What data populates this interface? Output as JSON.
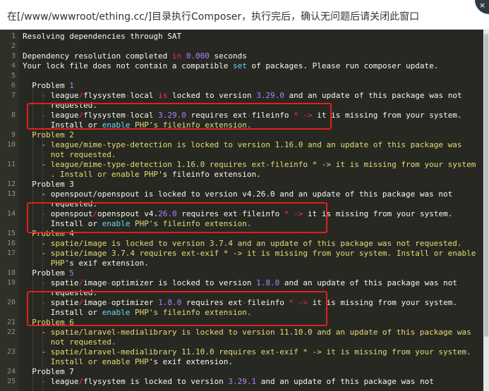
{
  "window": {
    "title": "在[/www/wwwroot/ething.cc/]目录执行Composer，执行完后，确认无问题后请关闭此窗口",
    "close_label": "×"
  },
  "colors": {
    "editor_bg": "#272822",
    "white": "#f8f8f2",
    "yellow": "#e6db74",
    "purple": "#ae81ff",
    "pink": "#f92672",
    "blue": "#66d9ef",
    "highlight_box": "#e2201d"
  },
  "lines": [
    {
      "n": "1",
      "segs": [
        {
          "t": "Resolving dependencies through SAT",
          "c": "white"
        }
      ]
    },
    {
      "n": "2",
      "segs": []
    },
    {
      "n": "3",
      "segs": [
        {
          "t": "Dependency resolution completed ",
          "c": "white"
        },
        {
          "t": "in",
          "c": "pink"
        },
        {
          "t": " ",
          "c": "white"
        },
        {
          "t": "0.000",
          "c": "purple"
        },
        {
          "t": " seconds",
          "c": "white"
        }
      ]
    },
    {
      "n": "4",
      "segs": [
        {
          "t": "Your lock file does not contain a compatible ",
          "c": "white"
        },
        {
          "t": "set",
          "c": "blue"
        },
        {
          "t": " of packages. Please run composer update.",
          "c": "white"
        }
      ]
    },
    {
      "n": "5",
      "segs": []
    },
    {
      "n": "6",
      "segs": [
        {
          "t": "  Problem ",
          "c": "white"
        },
        {
          "t": "1",
          "c": "purple"
        }
      ]
    },
    {
      "n": "7",
      "segs": [
        {
          "t": "    ",
          "c": "white"
        },
        {
          "t": "-",
          "c": "pink"
        },
        {
          "t": " league",
          "c": "white"
        },
        {
          "t": "/",
          "c": "pink"
        },
        {
          "t": "flysystem",
          "c": "white"
        },
        {
          "t": "-",
          "c": "pink"
        },
        {
          "t": "local ",
          "c": "white"
        },
        {
          "t": "is",
          "c": "pink"
        },
        {
          "t": " locked to version ",
          "c": "white"
        },
        {
          "t": "3.29.0",
          "c": "purple"
        },
        {
          "t": " and an update of this package was not",
          "c": "white"
        }
      ]
    },
    {
      "n": "",
      "segs": [
        {
          "t": "      requested.",
          "c": "white"
        }
      ]
    },
    {
      "n": "8",
      "segs": [
        {
          "t": "    ",
          "c": "white"
        },
        {
          "t": "-",
          "c": "pink"
        },
        {
          "t": " league",
          "c": "white"
        },
        {
          "t": "/",
          "c": "pink"
        },
        {
          "t": "flysystem",
          "c": "white"
        },
        {
          "t": "-",
          "c": "pink"
        },
        {
          "t": "local ",
          "c": "white"
        },
        {
          "t": "3.29.0",
          "c": "purple"
        },
        {
          "t": " requires ext",
          "c": "white"
        },
        {
          "t": "-",
          "c": "pink"
        },
        {
          "t": "fileinfo ",
          "c": "white"
        },
        {
          "t": "* ->",
          "c": "pink"
        },
        {
          "t": " it is missing from your system.",
          "c": "white"
        }
      ]
    },
    {
      "n": "",
      "segs": [
        {
          "t": "      Install or ",
          "c": "white"
        },
        {
          "t": "enable",
          "c": "blue"
        },
        {
          "t": " PHP's fileinfo extension.",
          "c": "yellow"
        }
      ]
    },
    {
      "n": "9",
      "segs": [
        {
          "t": "  Problem 2",
          "c": "yellow"
        }
      ]
    },
    {
      "n": "10",
      "segs": [
        {
          "t": "    - league/mime-type-detection is locked to version 1.16.0 and an update of this package was",
          "c": "yellow"
        }
      ]
    },
    {
      "n": "",
      "segs": [
        {
          "t": "      not requested.",
          "c": "yellow"
        }
      ]
    },
    {
      "n": "11",
      "segs": [
        {
          "t": "    - league/mime-type-detection 1.16.0 requires ext-fileinfo * -> it is missing from your system",
          "c": "yellow"
        }
      ]
    },
    {
      "n": "",
      "segs": [
        {
          "t": "      . Install or enable PHP",
          "c": "yellow"
        },
        {
          "t": "'s fileinfo extension.",
          "c": "white"
        }
      ]
    },
    {
      "n": "12",
      "segs": [
        {
          "t": "  Problem 3",
          "c": "white"
        }
      ]
    },
    {
      "n": "13",
      "segs": [
        {
          "t": "    - openspout/openspout is locked to version v4.26.0 and an update of this package was not",
          "c": "white"
        }
      ]
    },
    {
      "n": "",
      "segs": [
        {
          "t": "      requested.",
          "c": "white"
        }
      ]
    },
    {
      "n": "14",
      "segs": [
        {
          "t": "    ",
          "c": "white"
        },
        {
          "t": "-",
          "c": "pink"
        },
        {
          "t": " openspout",
          "c": "white"
        },
        {
          "t": "/",
          "c": "pink"
        },
        {
          "t": "openspout v4.",
          "c": "white"
        },
        {
          "t": "26.0",
          "c": "purple"
        },
        {
          "t": " requires ext",
          "c": "white"
        },
        {
          "t": "-",
          "c": "pink"
        },
        {
          "t": "fileinfo ",
          "c": "white"
        },
        {
          "t": "* ->",
          "c": "pink"
        },
        {
          "t": " it is missing from your system.",
          "c": "white"
        }
      ]
    },
    {
      "n": "",
      "segs": [
        {
          "t": "      Install or ",
          "c": "white"
        },
        {
          "t": "enable",
          "c": "blue"
        },
        {
          "t": " PHP's fileinfo extension.",
          "c": "yellow"
        }
      ]
    },
    {
      "n": "15",
      "segs": [
        {
          "t": "  Problem 4",
          "c": "yellow"
        }
      ]
    },
    {
      "n": "16",
      "segs": [
        {
          "t": "    - spatie/image is locked to version 3.7.4 and an update of this package was not requested.",
          "c": "yellow"
        }
      ]
    },
    {
      "n": "17",
      "segs": [
        {
          "t": "    - spatie/image 3.7.4 requires ext-exif * -> it is missing from your system. Install or enable",
          "c": "yellow"
        }
      ]
    },
    {
      "n": "",
      "segs": [
        {
          "t": "      PHP",
          "c": "yellow"
        },
        {
          "t": "'s exif extension.",
          "c": "white"
        }
      ]
    },
    {
      "n": "18",
      "segs": [
        {
          "t": "  Problem ",
          "c": "white"
        },
        {
          "t": "5",
          "c": "purple"
        }
      ]
    },
    {
      "n": "19",
      "segs": [
        {
          "t": "    ",
          "c": "white"
        },
        {
          "t": "-",
          "c": "pink"
        },
        {
          "t": " spatie",
          "c": "white"
        },
        {
          "t": "/",
          "c": "pink"
        },
        {
          "t": "image",
          "c": "white"
        },
        {
          "t": "-",
          "c": "pink"
        },
        {
          "t": "optimizer is locked to version ",
          "c": "white"
        },
        {
          "t": "1.8.0",
          "c": "purple"
        },
        {
          "t": " and an update of this package was not",
          "c": "white"
        }
      ]
    },
    {
      "n": "",
      "segs": [
        {
          "t": "      requested.",
          "c": "white"
        }
      ]
    },
    {
      "n": "20",
      "segs": [
        {
          "t": "    ",
          "c": "white"
        },
        {
          "t": "-",
          "c": "pink"
        },
        {
          "t": " spatie",
          "c": "white"
        },
        {
          "t": "/",
          "c": "pink"
        },
        {
          "t": "image",
          "c": "white"
        },
        {
          "t": "-",
          "c": "pink"
        },
        {
          "t": "optimizer ",
          "c": "white"
        },
        {
          "t": "1.8.0",
          "c": "purple"
        },
        {
          "t": " requires ext",
          "c": "white"
        },
        {
          "t": "-",
          "c": "pink"
        },
        {
          "t": "fileinfo ",
          "c": "white"
        },
        {
          "t": "* ->",
          "c": "pink"
        },
        {
          "t": " it is missing from your system.",
          "c": "white"
        }
      ]
    },
    {
      "n": "",
      "segs": [
        {
          "t": "      Install or ",
          "c": "white"
        },
        {
          "t": "enable",
          "c": "blue"
        },
        {
          "t": " PHP's fileinfo extension.",
          "c": "yellow"
        }
      ]
    },
    {
      "n": "21",
      "segs": [
        {
          "t": "  Problem 6",
          "c": "yellow"
        }
      ]
    },
    {
      "n": "22",
      "segs": [
        {
          "t": "    - spatie/laravel-medialibrary is locked to version 11.10.0 and an update of this package was",
          "c": "yellow"
        }
      ]
    },
    {
      "n": "",
      "segs": [
        {
          "t": "      not requested.",
          "c": "yellow"
        }
      ]
    },
    {
      "n": "23",
      "segs": [
        {
          "t": "    - spatie/laravel-medialibrary 11.10.0 requires ext-exif * -> it is missing from your system.",
          "c": "yellow"
        }
      ]
    },
    {
      "n": "",
      "segs": [
        {
          "t": "      Install or enable PHP",
          "c": "yellow"
        },
        {
          "t": "'s exif extension.",
          "c": "white"
        }
      ]
    },
    {
      "n": "24",
      "segs": [
        {
          "t": "  Problem 7",
          "c": "white"
        }
      ]
    },
    {
      "n": "25",
      "segs": [
        {
          "t": "    ",
          "c": "white"
        },
        {
          "t": "-",
          "c": "pink"
        },
        {
          "t": " league",
          "c": "white"
        },
        {
          "t": "/",
          "c": "pink"
        },
        {
          "t": "flysystem is locked to version ",
          "c": "white"
        },
        {
          "t": "3.29.1",
          "c": "purple"
        },
        {
          "t": " and an update of this package was not",
          "c": "white"
        }
      ]
    }
  ]
}
